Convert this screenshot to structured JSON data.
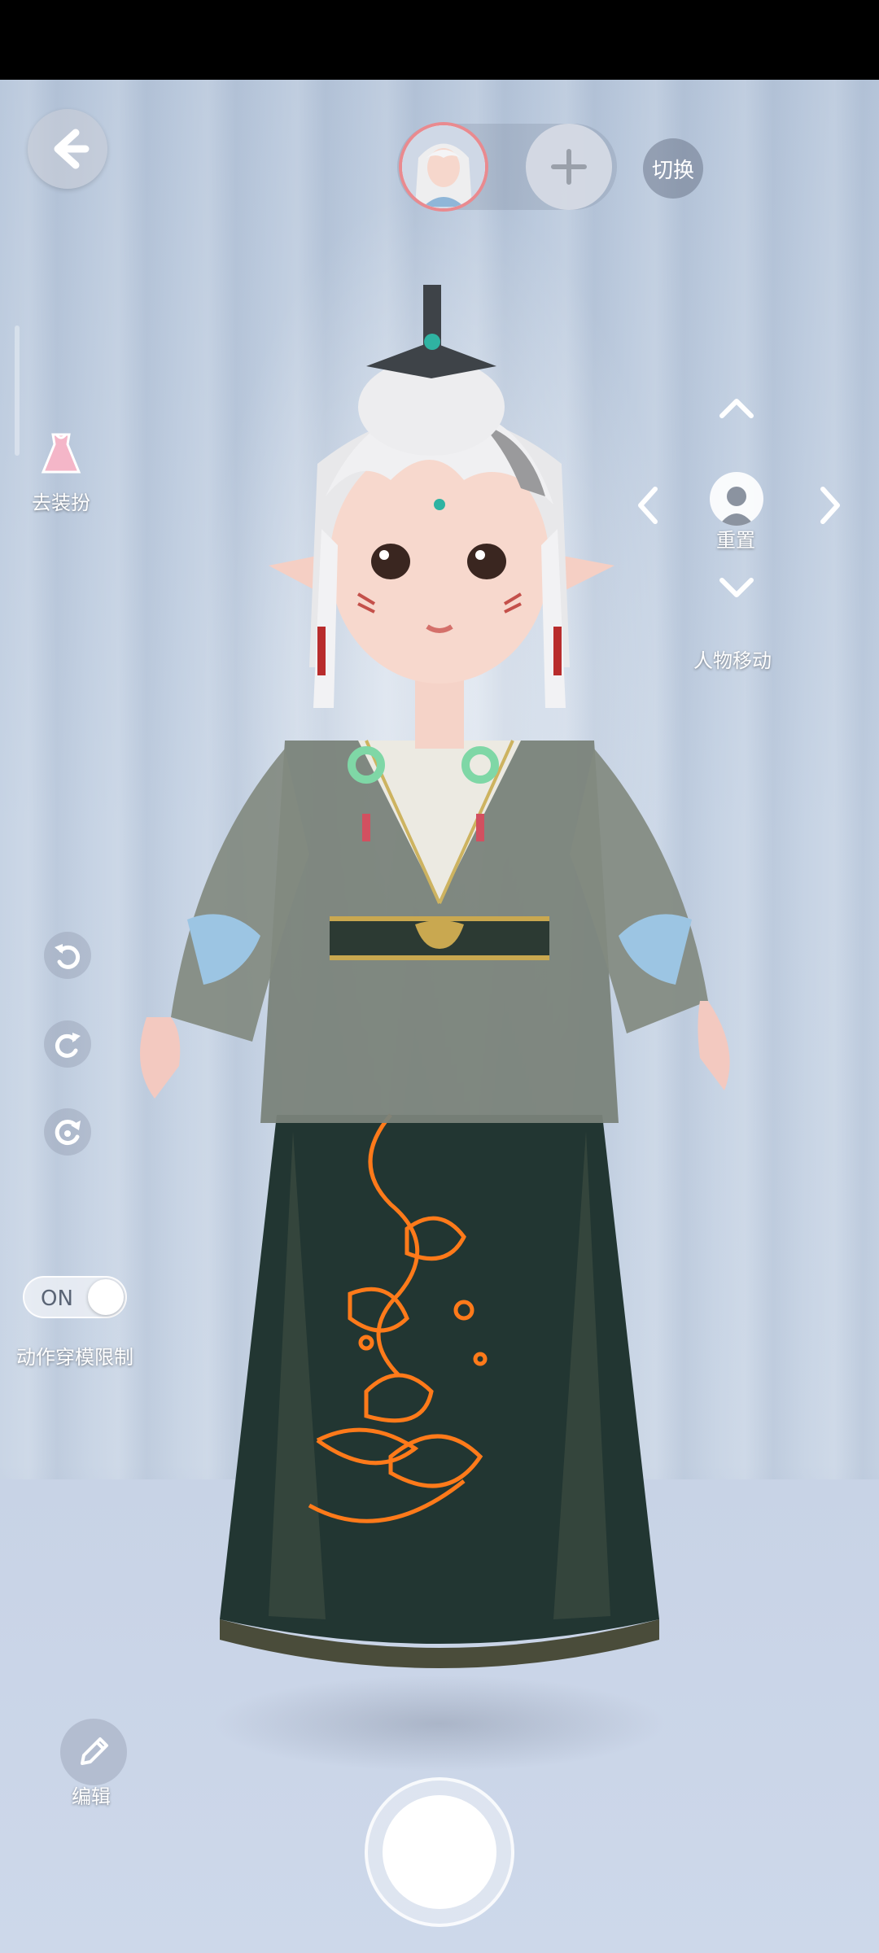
{
  "top": {
    "back_icon": "back-arrow-icon",
    "switch_label": "切换",
    "add_icon": "plus-icon"
  },
  "left": {
    "undress_label": "去装扮",
    "tools": [
      "undo-icon",
      "redo-icon",
      "refresh-icon"
    ],
    "toggle_state": "ON",
    "toggle_label": "动作穿模限制"
  },
  "right": {
    "reset_label": "重置",
    "move_label": "人物移动"
  },
  "bottom": {
    "edit_label": "编辑"
  },
  "colors": {
    "accent_ring": "#e98a8f",
    "label_text": "#ffffff",
    "skirt_pattern": "#ff7a1a"
  }
}
